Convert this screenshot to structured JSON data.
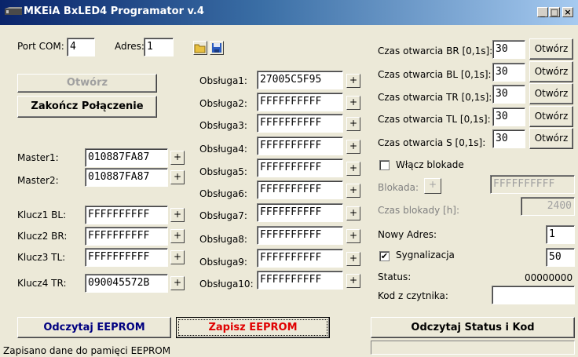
{
  "window": {
    "title": "MKEiA BxLED4 Programator v.4",
    "controls": [
      "_",
      "□",
      "×"
    ]
  },
  "connection": {
    "port_label": "Port COM:",
    "port_value": "4",
    "addr_label": "Adres:",
    "addr_value": "1",
    "open_label": "Otwórz",
    "close_label": "Zakończ Połączenie"
  },
  "masters": [
    {
      "label": "Master1:",
      "value": "010887FA87"
    },
    {
      "label": "Master2:",
      "value": "010887FA87"
    }
  ],
  "keys": [
    {
      "label": "Klucz1 BL:",
      "value": "FFFFFFFFFF"
    },
    {
      "label": "Klucz2 BR:",
      "value": "FFFFFFFFFF"
    },
    {
      "label": "Klucz3 TL:",
      "value": "FFFFFFFFFF"
    },
    {
      "label": "Klucz4 TR:",
      "value": "090045572B"
    }
  ],
  "obslugi": [
    {
      "label": "Obsługa1:",
      "value": "27005C5F95"
    },
    {
      "label": "Obsługa2:",
      "value": "FFFFFFFFFF"
    },
    {
      "label": "Obsługa3:",
      "value": "FFFFFFFFFF"
    },
    {
      "label": "Obsługa4:",
      "value": "FFFFFFFFFF"
    },
    {
      "label": "Obsługa5:",
      "value": "FFFFFFFFFF"
    },
    {
      "label": "Obsługa6:",
      "value": "FFFFFFFFFF"
    },
    {
      "label": "Obsługa7:",
      "value": "FFFFFFFFFF"
    },
    {
      "label": "Obsługa8:",
      "value": "FFFFFFFFFF"
    },
    {
      "label": "Obsługa9:",
      "value": "FFFFFFFFFF"
    },
    {
      "label": "Obsługa10:",
      "value": "FFFFFFFFFF"
    }
  ],
  "plus_label": "+",
  "timers": [
    {
      "label": "Czas otwarcia BR [0,1s]:",
      "value": "30",
      "btn": "Otwórz"
    },
    {
      "label": "Czas otwarcia BL [0,1s]:",
      "value": "30",
      "btn": "Otwórz"
    },
    {
      "label": "Czas otwarcia TR [0,1s]:",
      "value": "30",
      "btn": "Otwórz"
    },
    {
      "label": "Czas otwarcia TL [0,1s]:",
      "value": "30",
      "btn": "Otwórz"
    },
    {
      "label": "Czas otwarcia S [0,1s]:",
      "value": "30",
      "btn": "Otwórz"
    }
  ],
  "lock": {
    "enable_label": "Włącz blokade",
    "enabled": false,
    "label": "Blokada:",
    "value": "FFFFFFFFFF",
    "time_label": "Czas blokady [h]:",
    "time_value": "2400"
  },
  "settings": {
    "new_addr_label": "Nowy Adres:",
    "new_addr_value": "1",
    "signal_label": "Sygnalizacja",
    "signal_checked": true,
    "signal_check_glyph": "✔",
    "signal_value": "50",
    "status_label": "Status:",
    "status_value": "00000000",
    "reader_label": "Kod z czytnika:",
    "reader_value": ""
  },
  "actions": {
    "read_label": "Odczytaj EEPROM",
    "write_label": "Zapisz EEPROM",
    "read_status_label": "Odczytaj Status i Kod"
  },
  "colors": {
    "read": "#000080",
    "write": "#e00000"
  },
  "statusbar": {
    "message": "Zapisano dane do pamięci EEPROM"
  }
}
